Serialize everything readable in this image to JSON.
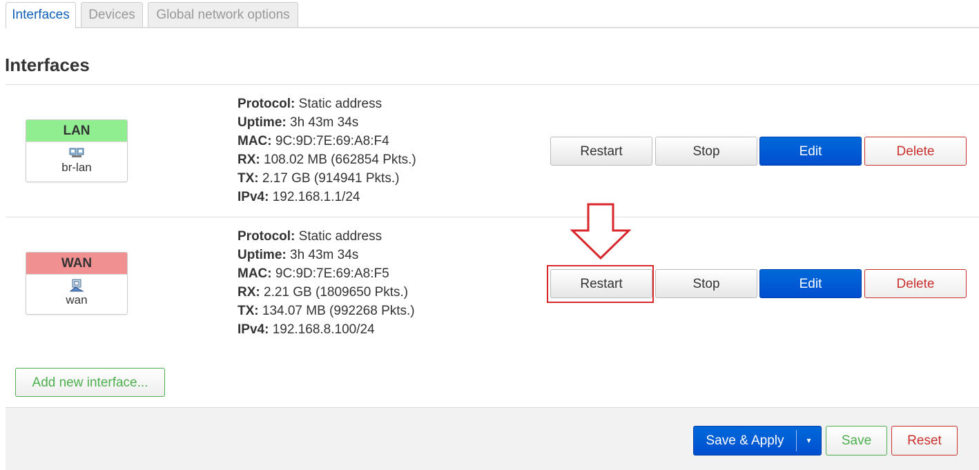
{
  "tabs": [
    {
      "label": "Interfaces",
      "active": true
    },
    {
      "label": "Devices",
      "active": false
    },
    {
      "label": "Global network options",
      "active": false
    }
  ],
  "page_title": "Interfaces",
  "interfaces": [
    {
      "name": "LAN",
      "color": "#90ee90",
      "device": "br-lan",
      "icon": "bridge-network-icon",
      "details": [
        {
          "key": "Protocol:",
          "value": "Static address"
        },
        {
          "key": "Uptime:",
          "value": "3h 43m 34s"
        },
        {
          "key": "MAC:",
          "value": "9C:9D:7E:69:A8:F4"
        },
        {
          "key": "RX:",
          "value": "108.02 MB (662854 Pkts.)"
        },
        {
          "key": "TX:",
          "value": "2.17 GB (914941 Pkts.)"
        },
        {
          "key": "IPv4:",
          "value": "192.168.1.1/24"
        }
      ]
    },
    {
      "name": "WAN",
      "color": "#f09090",
      "device": "wan",
      "icon": "ethernet-port-icon",
      "details": [
        {
          "key": "Protocol:",
          "value": "Static address"
        },
        {
          "key": "Uptime:",
          "value": "3h 43m 34s"
        },
        {
          "key": "MAC:",
          "value": "9C:9D:7E:69:A8:F5"
        },
        {
          "key": "RX:",
          "value": "2.21 GB (1809650 Pkts.)"
        },
        {
          "key": "TX:",
          "value": "134.07 MB (992268 Pkts.)"
        },
        {
          "key": "IPv4:",
          "value": "192.168.8.100/24"
        }
      ]
    }
  ],
  "row_buttons": {
    "restart": "Restart",
    "stop": "Stop",
    "edit": "Edit",
    "delete": "Delete"
  },
  "add_interface_label": "Add new interface...",
  "footer": {
    "save_apply": "Save & Apply",
    "caret": "▾",
    "save": "Save",
    "reset": "Reset"
  },
  "colors": {
    "accent": "#0069d9",
    "danger": "#c9302c",
    "success": "#4cae4c",
    "annotation": "#d8262a"
  }
}
